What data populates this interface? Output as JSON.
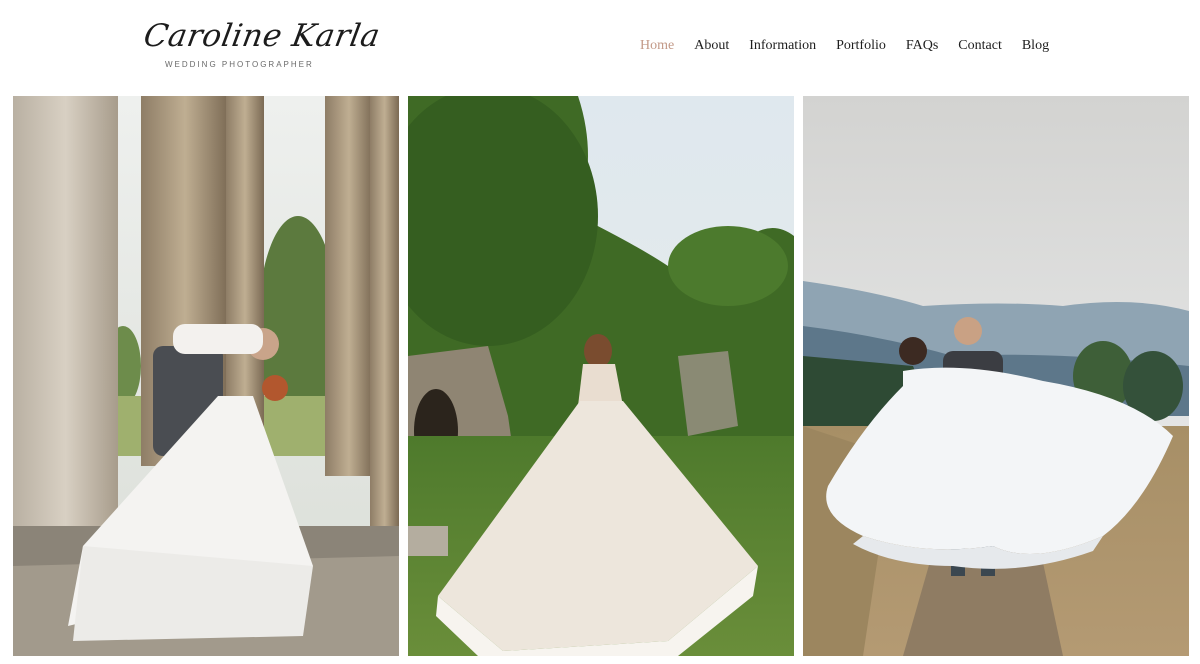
{
  "brand": {
    "name": "Caroline Karla",
    "tagline": "WEDDING PHOTOGRAPHER"
  },
  "nav": {
    "items": [
      {
        "label": "Home",
        "active": true
      },
      {
        "label": "About",
        "active": false
      },
      {
        "label": "Information",
        "active": false
      },
      {
        "label": "Portfolio",
        "active": false
      },
      {
        "label": "FAQs",
        "active": false
      },
      {
        "label": "Contact",
        "active": false
      },
      {
        "label": "Blog",
        "active": false
      }
    ]
  },
  "colors": {
    "accent": "#c39a88",
    "text": "#1e1e1e"
  },
  "gallery": {
    "photos": [
      {
        "subject": "couple-dip-kiss-among-stone-columns"
      },
      {
        "subject": "bride-in-lace-gown-garden-ruins"
      },
      {
        "subject": "groom-lifting-bride-mountain-trail"
      }
    ]
  }
}
